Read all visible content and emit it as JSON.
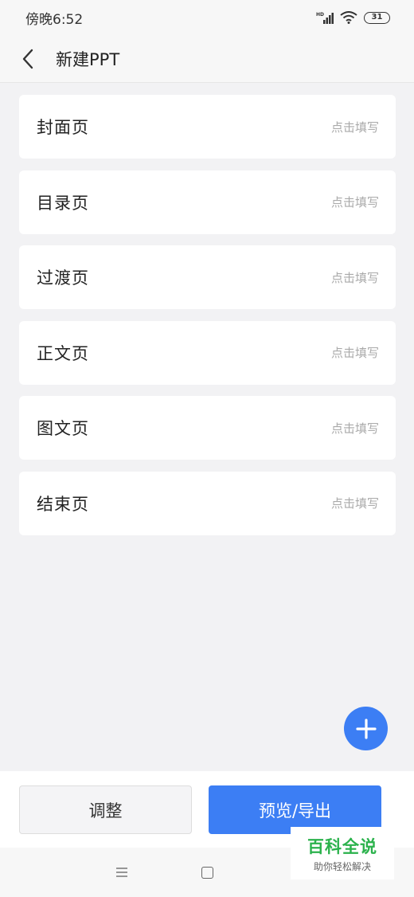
{
  "status_bar": {
    "time": "傍晚6:52",
    "battery": "31"
  },
  "header": {
    "title": "新建PPT",
    "back_icon": "chevron-left-icon"
  },
  "cards": [
    {
      "title": "封面页",
      "hint": "点击填写"
    },
    {
      "title": "目录页",
      "hint": "点击填写"
    },
    {
      "title": "过渡页",
      "hint": "点击填写"
    },
    {
      "title": "正文页",
      "hint": "点击填写"
    },
    {
      "title": "图文页",
      "hint": "点击填写"
    },
    {
      "title": "结束页",
      "hint": "点击填写"
    }
  ],
  "fab": {
    "icon": "plus-icon"
  },
  "bottom": {
    "adjust_label": "调整",
    "preview_label": "预览/导出"
  },
  "watermark": {
    "title": "百科全说",
    "subtitle": "助你轻松解决"
  },
  "colors": {
    "accent": "#3c7ef4",
    "background": "#f2f2f4",
    "watermark_green": "#2bb24c"
  }
}
